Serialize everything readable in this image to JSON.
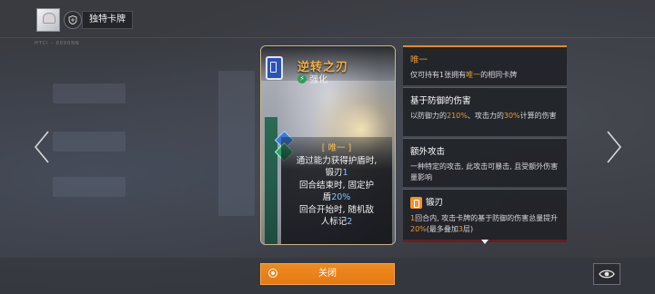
{
  "header": {
    "title": "独特卡牌",
    "meta_small": "HTCI - 0000NN"
  },
  "card": {
    "name": "逆转之刃",
    "type": "强化",
    "rarity_tag": "[ 唯一 ]",
    "desc_line1": "通过能力获得护盾时,",
    "desc_line2a": "锻刃",
    "desc_line2b": "1",
    "desc_line3": "回合结束时, 固定护",
    "desc_line4a": "盾",
    "desc_line4b": "20%",
    "desc_line5": "回合开始时, 随机敌",
    "desc_line6a": "人标记",
    "desc_line6b": "2"
  },
  "panels": [
    {
      "title": "唯一",
      "body_a": "仅可持有1张拥有",
      "body_hl": "唯一",
      "body_b": "的相同卡牌"
    },
    {
      "title": "基于防御的伤害",
      "body_a": "以防御力的",
      "hl1": "210%",
      "body_b": "、攻击力的",
      "hl2": "30%",
      "body_c": "计算的伤害"
    },
    {
      "title": "额外攻击",
      "body": "一种特定的攻击, 此攻击可暴击, 且受额外伤害量影响"
    },
    {
      "title": "锻刃",
      "body_a": "1",
      "body_b": "回合内, 攻击卡牌的基于防御的伤害总量提升",
      "hl1": "20%",
      "body_c": "(最多叠加",
      "hl2": "3",
      "body_d": "层)"
    }
  ],
  "buttons": {
    "close_label": "关闭"
  },
  "colors": {
    "accent": "#f08a1e",
    "panel_bg": "#1c1e23"
  }
}
